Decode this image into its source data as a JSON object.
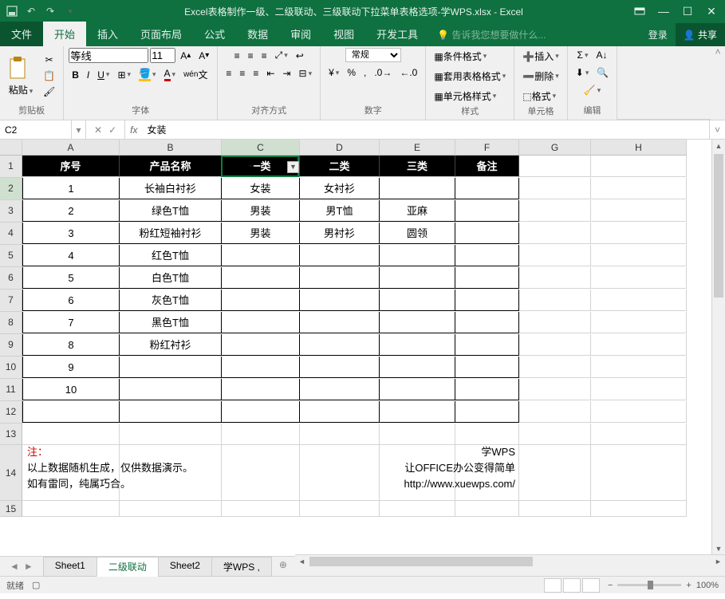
{
  "title": "Excel表格制作一级、二级联动、三级联动下拉菜单表格选项-学WPS.xlsx - Excel",
  "menu": {
    "file": "文件",
    "home": "开始",
    "insert": "插入",
    "layout": "页面布局",
    "formula": "公式",
    "data": "数据",
    "review": "审阅",
    "view": "视图",
    "dev": "开发工具",
    "tellme": "告诉我您想要做什么...",
    "login": "登录",
    "share": "共享"
  },
  "ribbon": {
    "clipboard": {
      "label": "剪贴板",
      "paste": "粘贴"
    },
    "font": {
      "label": "字体",
      "name": "等线",
      "size": "11"
    },
    "align": {
      "label": "对齐方式"
    },
    "number": {
      "label": "数字",
      "format": "常规"
    },
    "styles": {
      "label": "样式",
      "cond": "条件格式",
      "table": "套用表格格式",
      "cell": "单元格样式"
    },
    "cells": {
      "label": "单元格",
      "insert": "插入",
      "delete": "删除",
      "format": "格式"
    },
    "edit": {
      "label": "编辑"
    }
  },
  "namebox": "C2",
  "formula": "女装",
  "columns": [
    "A",
    "B",
    "C",
    "D",
    "E",
    "F",
    "G",
    "H"
  ],
  "rows": [
    "1",
    "2",
    "3",
    "4",
    "5",
    "6",
    "7",
    "8",
    "9",
    "10",
    "11",
    "12",
    "13",
    "14",
    "15"
  ],
  "headers": {
    "a": "序号",
    "b": "产品名称",
    "c": "一类",
    "d": "二类",
    "e": "三类",
    "f": "备注"
  },
  "data": {
    "r2": {
      "a": "1",
      "b": "长袖白衬衫",
      "c": "女装",
      "d": "女衬衫",
      "e": "",
      "f": ""
    },
    "r3": {
      "a": "2",
      "b": "绿色T恤",
      "c": "男装",
      "d": "男T恤",
      "e": "亚麻",
      "f": ""
    },
    "r4": {
      "a": "3",
      "b": "粉红短袖衬衫",
      "c": "男装",
      "d": "男衬衫",
      "e": "圆领",
      "f": ""
    },
    "r5": {
      "a": "4",
      "b": "红色T恤"
    },
    "r6": {
      "a": "5",
      "b": "白色T恤"
    },
    "r7": {
      "a": "6",
      "b": "灰色T恤"
    },
    "r8": {
      "a": "7",
      "b": "黑色T恤"
    },
    "r9": {
      "a": "8",
      "b": "粉红衬衫"
    },
    "r10": {
      "a": "9"
    },
    "r11": {
      "a": "10"
    }
  },
  "notes": {
    "n1": "注：",
    "n2": "以上数据随机生成，仅供数据演示。",
    "n3": "如有雷同，纯属巧合。",
    "r1": "学WPS",
    "r2": "让OFFICE办公变得简单",
    "r3": "http://www.xuewps.com/"
  },
  "sheets": {
    "s1": "Sheet1",
    "s2": "二级联动",
    "s3": "Sheet2",
    "s4": "学WPS ,"
  },
  "status": {
    "ready": "就绪",
    "zoom": "100%"
  },
  "chart_data": null
}
